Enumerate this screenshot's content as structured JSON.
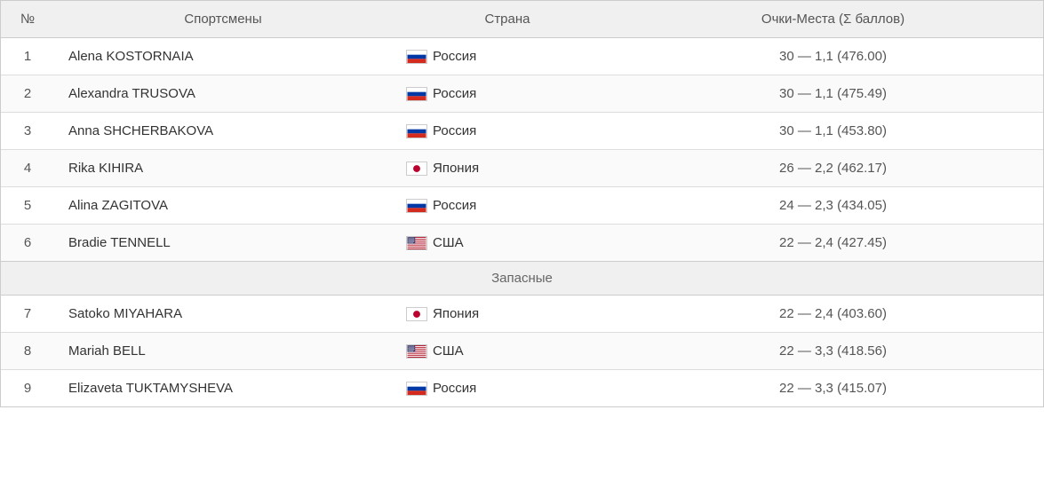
{
  "header": {
    "col_num": "№",
    "col_athlete": "Спортсмены",
    "col_country": "Страна",
    "col_score": "Очки-Места (Σ баллов)"
  },
  "separator": {
    "label": "Запасные"
  },
  "rows": [
    {
      "num": "1",
      "athlete": "Alena KOSTORNAIA",
      "country_name": "Россия",
      "country_flag": "ru",
      "score": "30 — 1,1 (476.00)"
    },
    {
      "num": "2",
      "athlete": "Alexandra TRUSOVA",
      "country_name": "Россия",
      "country_flag": "ru",
      "score": "30 — 1,1 (475.49)"
    },
    {
      "num": "3",
      "athlete": "Anna SHCHERBAKOVA",
      "country_name": "Россия",
      "country_flag": "ru",
      "score": "30 — 1,1 (453.80)"
    },
    {
      "num": "4",
      "athlete": "Rika KIHIRA",
      "country_name": "Япония",
      "country_flag": "jp",
      "score": "26 — 2,2 (462.17)"
    },
    {
      "num": "5",
      "athlete": "Alina ZAGITOVA",
      "country_name": "Россия",
      "country_flag": "ru",
      "score": "24 — 2,3 (434.05)"
    },
    {
      "num": "6",
      "athlete": "Bradie TENNELL",
      "country_name": "США",
      "country_flag": "us",
      "score": "22 — 2,4 (427.45)"
    }
  ],
  "reserve_rows": [
    {
      "num": "7",
      "athlete": "Satoko MIYAHARA",
      "country_name": "Япония",
      "country_flag": "jp",
      "score": "22 — 2,4 (403.60)"
    },
    {
      "num": "8",
      "athlete": "Mariah BELL",
      "country_name": "США",
      "country_flag": "us",
      "score": "22 — 3,3 (418.56)"
    },
    {
      "num": "9",
      "athlete": "Elizaveta TUKTAMYSHEVA",
      "country_name": "Россия",
      "country_flag": "ru",
      "score": "22 — 3,3 (415.07)"
    }
  ]
}
